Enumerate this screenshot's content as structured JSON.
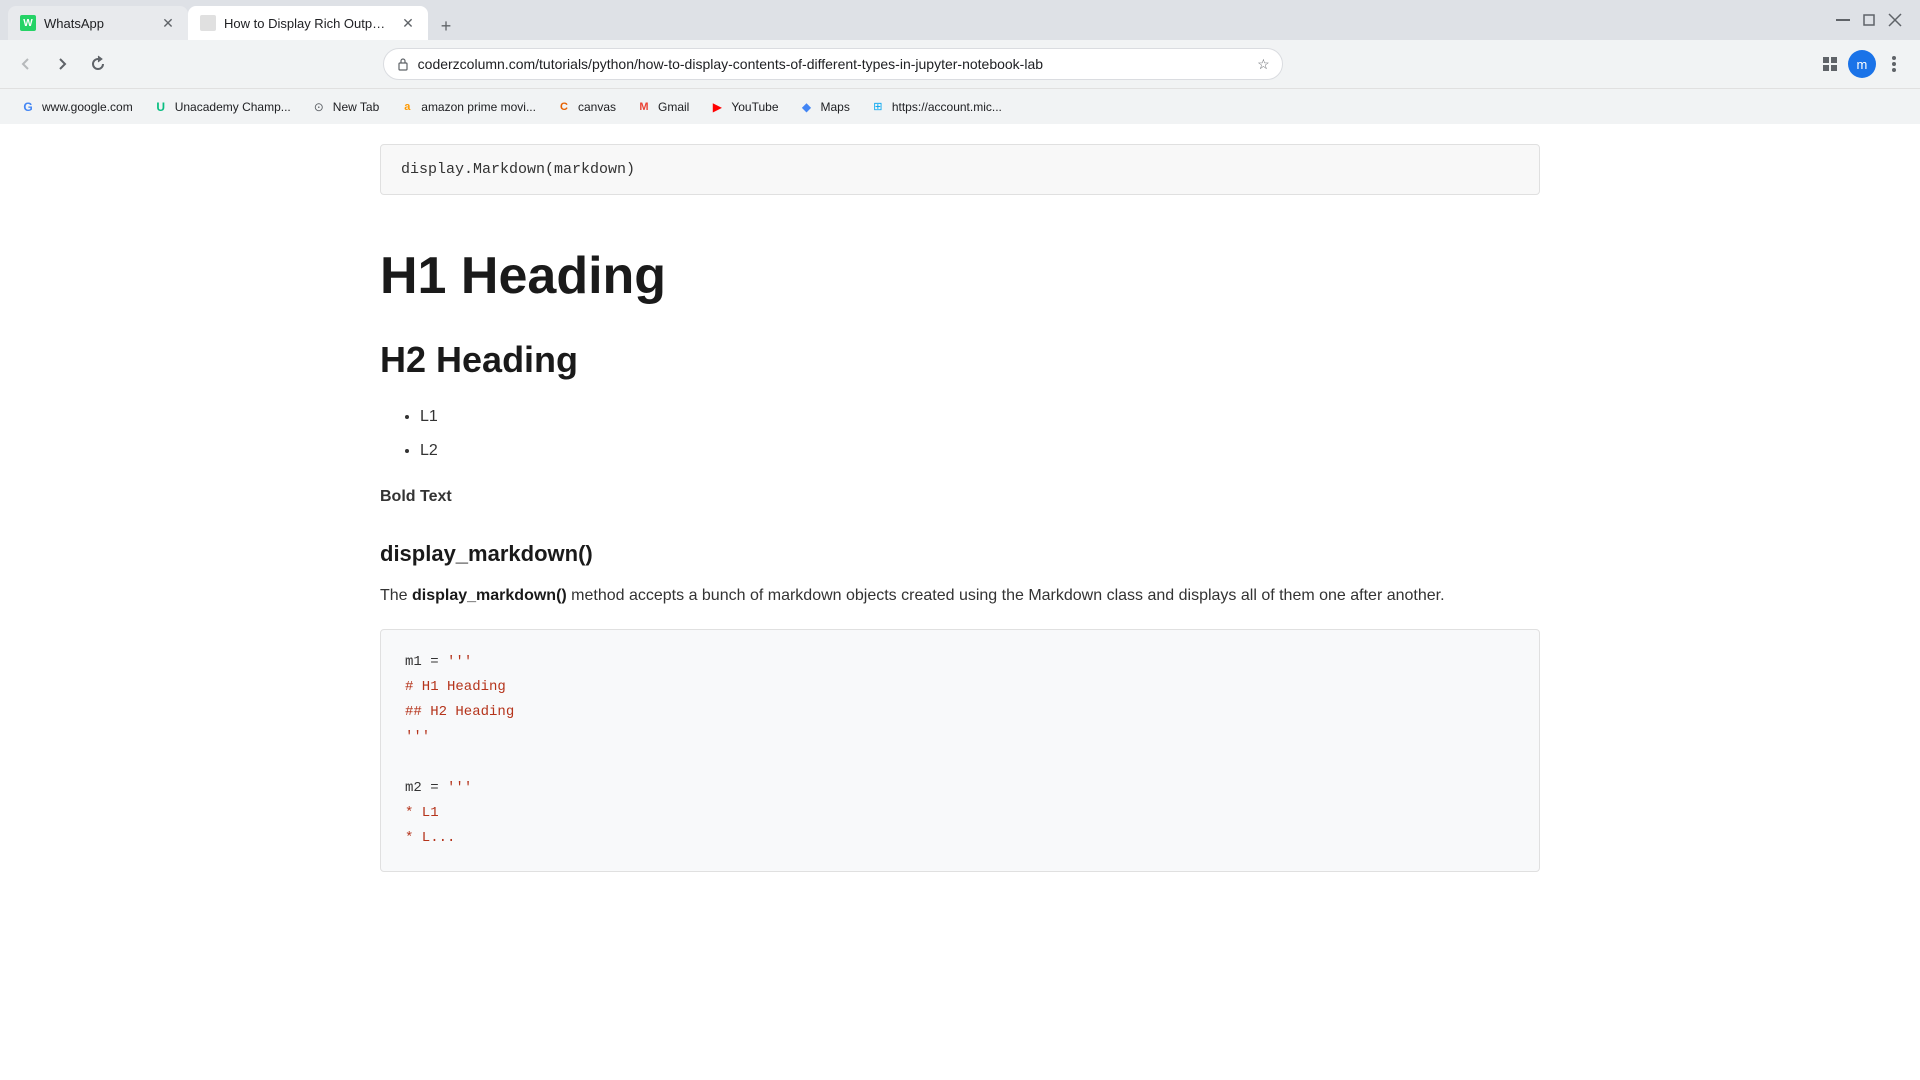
{
  "browser": {
    "tabs": [
      {
        "id": "tab-whatsapp",
        "title": "WhatsApp",
        "favicon_type": "whatsapp",
        "active": false
      },
      {
        "id": "tab-article",
        "title": "How to Display Rich Outputs (im...",
        "favicon_type": "article",
        "active": true
      }
    ],
    "new_tab_label": "+",
    "window_controls": {
      "minimize": "—",
      "maximize": "⬜",
      "close": "✕"
    },
    "address_bar": {
      "url": "coderzcolumn.com/tutorials/python/how-to-display-contents-of-different-types-in-jupyter-notebook-lab"
    },
    "bookmarks": [
      {
        "id": "bm-google",
        "label": "www.google.com",
        "favicon": "G"
      },
      {
        "id": "bm-unacademy",
        "label": "Unacademy Champ...",
        "favicon": "U"
      },
      {
        "id": "bm-newtab",
        "label": "New Tab",
        "favicon": "★"
      },
      {
        "id": "bm-amazon",
        "label": "amazon prime movi...",
        "favicon": "a"
      },
      {
        "id": "bm-canvas",
        "label": "canvas",
        "favicon": "C"
      },
      {
        "id": "bm-gmail",
        "label": "Gmail",
        "favicon": "M"
      },
      {
        "id": "bm-youtube",
        "label": "YouTube",
        "favicon": "▶"
      },
      {
        "id": "bm-maps",
        "label": "Maps",
        "favicon": "◆"
      },
      {
        "id": "bm-microsoft",
        "label": "https://account.mic...",
        "favicon": "⊞"
      }
    ]
  },
  "page": {
    "code_top": "display.Markdown(markdown)",
    "h1_heading": "H1 Heading",
    "h2_heading": "H2 Heading",
    "list_items": [
      "L1",
      "L2"
    ],
    "bold_text": "Bold Text",
    "function_heading": "display_markdown()",
    "paragraph": {
      "prefix": "The ",
      "bold_part": "display_markdown()",
      "suffix": " method accepts a bunch of markdown objects created using the Markdown class and displays all of them one after another."
    },
    "code_block": {
      "line1_normal": "m1 = ",
      "line1_string": "'''",
      "line2_string": "# H1 Heading",
      "line3_string": "## H2 Heading",
      "line4_string": "'''",
      "line5_normal": "",
      "line6_normal": "m2 = ",
      "line6_string": "'''",
      "line7_string": "* L1",
      "line8_partial": "* L..."
    }
  }
}
